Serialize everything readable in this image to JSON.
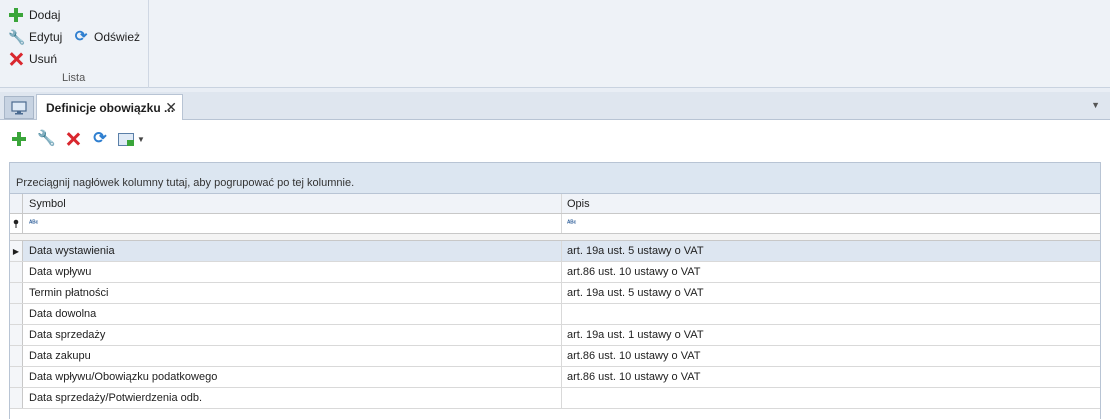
{
  "ribbon": {
    "add_label": "Dodaj",
    "edit_label": "Edytuj",
    "refresh_label": "Odśwież",
    "delete_label": "Usuń",
    "group_label": "Lista"
  },
  "tabs": {
    "active_label": "Definicje obowiązku ...",
    "close_glyph": "✕",
    "dropdown_glyph": "▼"
  },
  "grid": {
    "group_hint": "Przeciągnij nagłówek kolumny tutaj, aby pogrupować po tej kolumnie.",
    "columns": [
      "Symbol",
      "Opis"
    ],
    "filter_glyph": "ᴬᴮᶜ",
    "rows": [
      {
        "symbol": "Data wystawienia",
        "opis": "art. 19a ust. 5 ustawy o VAT",
        "selected": true
      },
      {
        "symbol": "Data wpływu",
        "opis": "art.86 ust. 10 ustawy o VAT"
      },
      {
        "symbol": "Termin płatności",
        "opis": "art. 19a ust. 5 ustawy o VAT"
      },
      {
        "symbol": "Data dowolna",
        "opis": ""
      },
      {
        "symbol": "Data sprzedaży",
        "opis": "art. 19a ust. 1 ustawy o VAT"
      },
      {
        "symbol": "Data zakupu",
        "opis": "art.86 ust. 10 ustawy o VAT"
      },
      {
        "symbol": "Data wpływu/Obowiązku podatkowego",
        "opis": "art.86 ust. 10 ustawy o VAT"
      },
      {
        "symbol": "Data sprzedaży/Potwierdzenia odb.",
        "opis": ""
      }
    ]
  },
  "colors": {
    "accent_green": "#3aa53a",
    "accent_red": "#d9272e",
    "accent_blue": "#2f7fd0",
    "selected_row": "#dde6f1"
  }
}
